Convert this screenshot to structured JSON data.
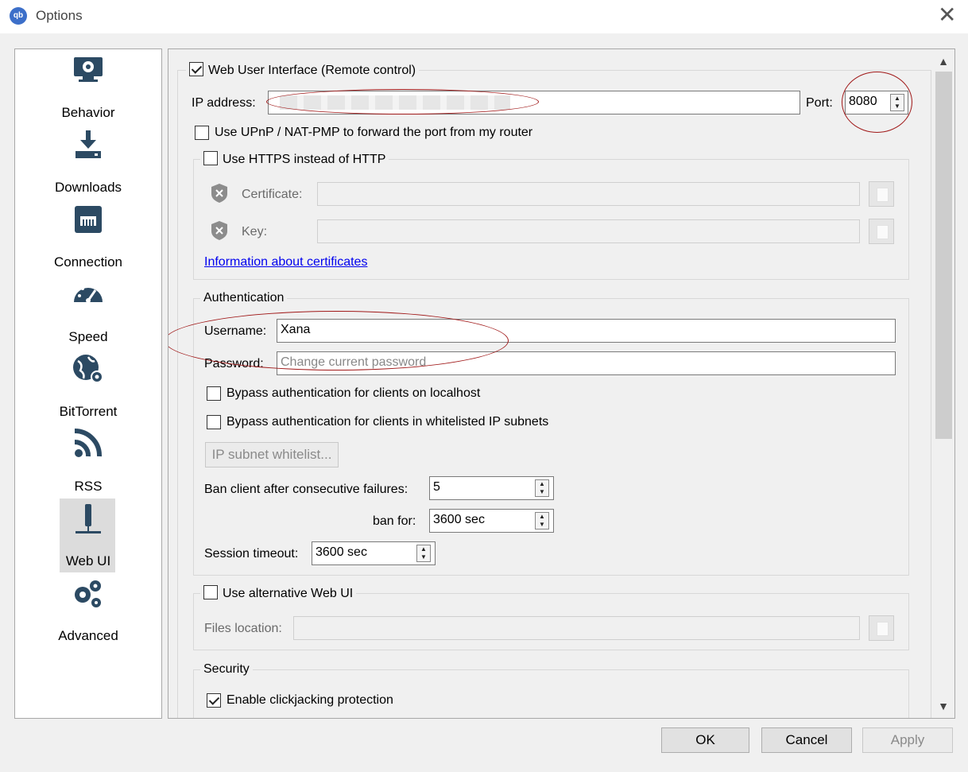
{
  "window": {
    "title": "Options",
    "app_icon": "qb",
    "close_glyph": "✕"
  },
  "sidebar": {
    "items": [
      {
        "label": "Behavior",
        "icon": "behavior-icon"
      },
      {
        "label": "Downloads",
        "icon": "downloads-icon"
      },
      {
        "label": "Connection",
        "icon": "connection-icon"
      },
      {
        "label": "Speed",
        "icon": "speed-icon"
      },
      {
        "label": "BitTorrent",
        "icon": "bittorrent-icon"
      },
      {
        "label": "RSS",
        "icon": "rss-icon"
      },
      {
        "label": "Web UI",
        "icon": "webui-icon",
        "selected": true
      },
      {
        "label": "Advanced",
        "icon": "advanced-icon"
      }
    ]
  },
  "webui": {
    "enable_label": "Web User Interface (Remote control)",
    "enabled": true,
    "ip_label": "IP address:",
    "ip_value": "",
    "port_label": "Port:",
    "port_value": "8080",
    "upnp_label": "Use UPnP / NAT-PMP to forward the port from my router",
    "upnp_checked": false,
    "https": {
      "label": "Use HTTPS instead of HTTP",
      "checked": false,
      "certificate_label": "Certificate:",
      "key_label": "Key:",
      "info_link": "Information about certificates"
    },
    "auth": {
      "title": "Authentication",
      "username_label": "Username:",
      "username_value": "Xana",
      "password_label": "Password:",
      "password_placeholder": "Change current password",
      "bypass_localhost": "Bypass authentication for clients on localhost",
      "bypass_whitelist": "Bypass authentication for clients in whitelisted IP subnets",
      "whitelist_button": "IP subnet whitelist...",
      "ban_label": "Ban client after consecutive failures:",
      "ban_value": "5",
      "ban_for_label": "ban for:",
      "ban_for_value": "3600 sec",
      "session_label": "Session timeout:",
      "session_value": "3600 sec"
    },
    "alt_ui": {
      "label": "Use alternative Web UI",
      "checked": false,
      "files_label": "Files location:"
    },
    "security": {
      "title": "Security",
      "clickjacking_label": "Enable clickjacking protection",
      "clickjacking_checked": true
    }
  },
  "buttons": {
    "ok": "OK",
    "cancel": "Cancel",
    "apply": "Apply"
  },
  "colors": {
    "annotation": "#a01818",
    "link": "#0000ee",
    "accent": "#3c6fc9"
  }
}
